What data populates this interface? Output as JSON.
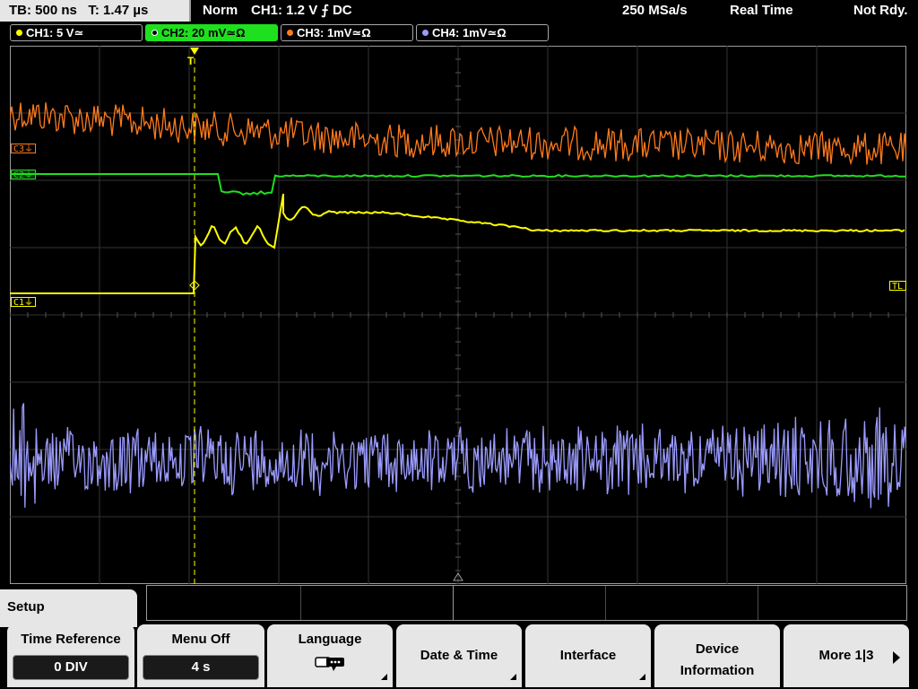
{
  "status": {
    "tb": "TB: 500 ns",
    "t": "T: 1.47 µs",
    "mode": "Norm",
    "trigger": "CH1: 1.2 V ⨍ DC",
    "sample_rate": "250 MSa/s",
    "acq": "Real Time",
    "state": "Not Rdy."
  },
  "channels": [
    {
      "label": "CH1: 5 V≃",
      "color": "#ffff00",
      "active": false
    },
    {
      "label": "CH2: 20 mV≃Ω",
      "color": "#1ee01e",
      "active": true
    },
    {
      "label": "CH3: 1mV≃Ω",
      "color": "#ff7a1c",
      "active": false
    },
    {
      "label": "CH4: 1mV≃Ω",
      "color": "#9b9bff",
      "active": false
    }
  ],
  "markers": {
    "c3": "C3⏚",
    "c2": "C2⏚",
    "c1": "C1⏚",
    "tl": "TL",
    "trigger_point": "T"
  },
  "colors": {
    "ch1": "#ffff00",
    "ch2": "#1ee01e",
    "ch3": "#ff7a1c",
    "ch4": "#9b9bff",
    "grid": "#3c3c3c"
  },
  "menu": {
    "title": "Setup",
    "time_reference": {
      "label": "Time Reference",
      "value": "0 DIV"
    },
    "menu_off": {
      "label": "Menu Off",
      "value": "4 s"
    },
    "language": {
      "label": "Language",
      "icon": "speech-bubble-icon"
    },
    "date_time": {
      "label": "Date & Time"
    },
    "interface": {
      "label": "Interface"
    },
    "device_info": {
      "label1": "Device",
      "label2": "Information"
    },
    "more": {
      "label": "More 1|3"
    }
  }
}
